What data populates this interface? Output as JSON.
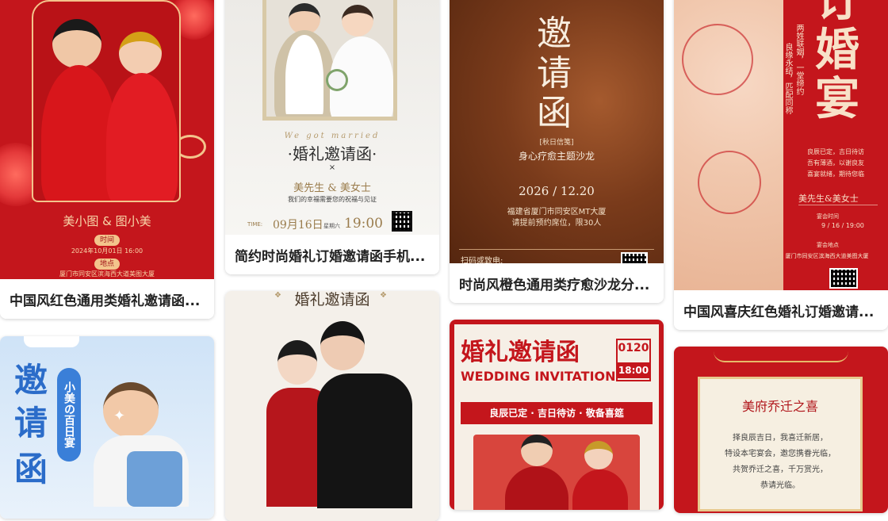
{
  "cards": [
    {
      "id": "c1",
      "title": "中国风红色通用类婚礼邀请函...",
      "names": "美小图 & 图小美",
      "time_label": "时间",
      "time_value": "2024年10月01日 16:00",
      "place_label": "地点",
      "place_value": "厦门市同安区滨海西大道美图大厦",
      "colors": {
        "bg": "#c4161c",
        "accent": "#f3c48c"
      }
    },
    {
      "id": "c2",
      "title": "简约时尚婚礼订婚邀请函手机...",
      "script": "We got married",
      "heading": "·婚礼邀请函·",
      "cross": "×",
      "names": "美先生 & 美女士",
      "sub": "我们的幸福需要您的祝福与见证",
      "time_label": "TIME:",
      "date": "09月16日",
      "weekday": "星期六",
      "clock": "19:00"
    },
    {
      "id": "c3",
      "title": "时尚风橙色通用类疗愈沙龙分...",
      "big": [
        "邀",
        "请",
        "函"
      ],
      "tag": "[秋日信笺]",
      "subtitle": "身心疗愈主题沙龙",
      "date": "2026 / 12.20",
      "address": "福建省厦门市同安区MT大厦",
      "note": "请提前预约席位，限30人",
      "scan": "扫码或致电:"
    },
    {
      "id": "c4",
      "title": "中国风喜庆红色婚礼订婚邀请...",
      "big": "订婚宴",
      "poem1": "两姓联姻，一堂缔约",
      "poem2": "良缘永结，匹配同称",
      "text1": "良辰已定，吉日待访",
      "text2": "吾有薄酒，以谢良友",
      "text3": "喜宴就绪，期待您临",
      "names": "美先生&美女士",
      "time_label": "宴会时间",
      "time_value": "9 / 16 / 19:00",
      "place_label": "宴会地点",
      "place_value": "厦门市同安区滨海西大道美图大厦"
    },
    {
      "id": "c5",
      "big": [
        "邀",
        "请",
        "函"
      ],
      "badge": "小美の百日宴"
    },
    {
      "id": "c6",
      "heading": "婚礼邀请函"
    },
    {
      "id": "c7",
      "heading": "婚礼邀请函",
      "date": "0120",
      "clock": "18:00",
      "en": "WEDDING INVITATION",
      "ribbon": "良辰已定 · 吉日待访 · 敬备喜筵"
    },
    {
      "id": "c8",
      "heading": "美府乔迁之喜",
      "lines": [
        "择良辰吉日，我喜迁新居，",
        "特设本宅宴会，邀您携眷光临，",
        "共贺乔迁之喜，千万赏光，",
        "恭请光临。"
      ]
    }
  ]
}
